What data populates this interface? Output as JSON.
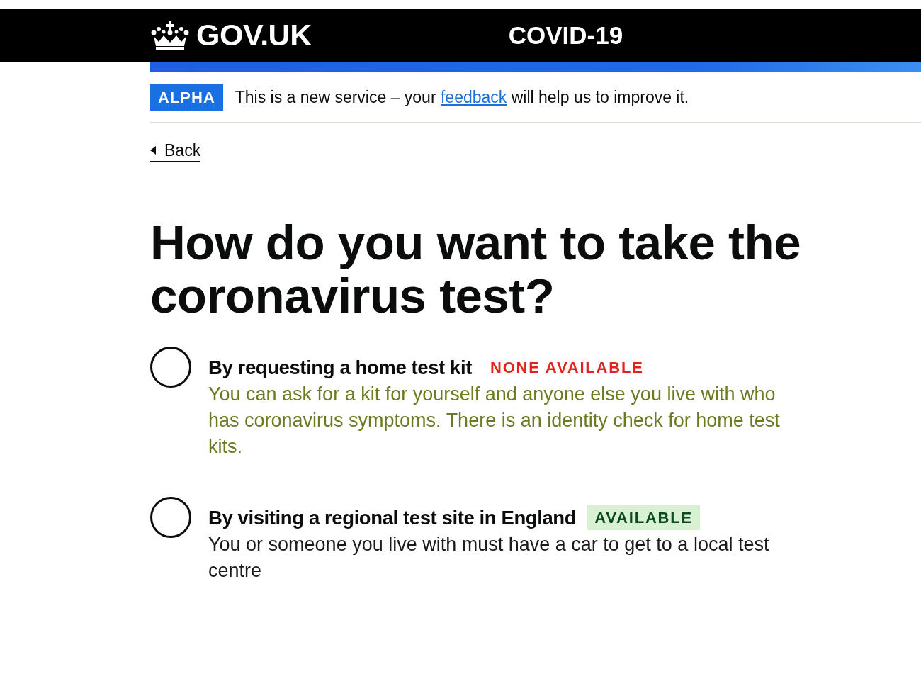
{
  "header": {
    "logo_text": "GOV.UK",
    "service_name": "COVID-19"
  },
  "phase_banner": {
    "tag": "ALPHA",
    "text_before": "This is a new service – your",
    "link": "feedback",
    "text_after": "will help us to improve it."
  },
  "back_link": "Back",
  "heading": "How do you want to take the coronavirus test?",
  "options": [
    {
      "label": "By requesting a home test kit",
      "selected": false,
      "available": false,
      "tag": "NONE AVAILABLE",
      "hint": "You can ask for a kit for yourself and anyone else you live with who has coronavirus symptoms. There is an identity check for home test kits."
    },
    {
      "label": "By visiting a regional test site in England",
      "selected": false,
      "available": true,
      "tag": "AVAILABLE",
      "hint": "You or someone you live with must have a car to get to a local test centre"
    }
  ]
}
